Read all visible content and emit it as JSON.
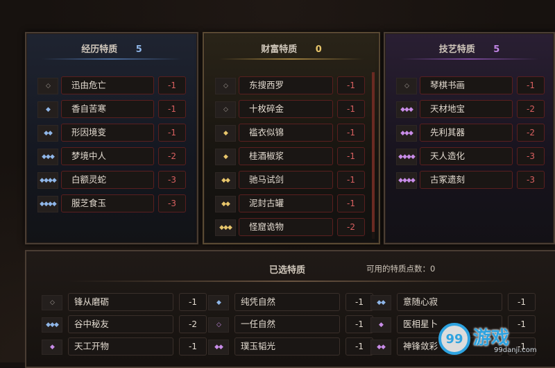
{
  "panels": {
    "experience": {
      "title": "经历特质",
      "count": "5",
      "items": [
        {
          "tier": "◇",
          "name": "迅由危亡",
          "cost": "-1"
        },
        {
          "tier": "◆",
          "name": "香自苦寒",
          "cost": "-1"
        },
        {
          "tier": "◆◆",
          "name": "形因境变",
          "cost": "-1"
        },
        {
          "tier": "◆◆◆",
          "name": "梦境中人",
          "cost": "-2"
        },
        {
          "tier": "◆◆◆◆",
          "name": "白额灵蛇",
          "cost": "-3"
        },
        {
          "tier": "◆◆◆◆",
          "name": "服芝食玉",
          "cost": "-3"
        }
      ]
    },
    "wealth": {
      "title": "财富特质",
      "count": "0",
      "items": [
        {
          "tier": "◇",
          "name": "东搜西罗",
          "cost": "-1"
        },
        {
          "tier": "◇",
          "name": "十枚碎金",
          "cost": "-1"
        },
        {
          "tier": "◆",
          "name": "褴衣似锦",
          "cost": "-1"
        },
        {
          "tier": "◆",
          "name": "桂酒椒浆",
          "cost": "-1"
        },
        {
          "tier": "◆◆",
          "name": "驰马试剑",
          "cost": "-1"
        },
        {
          "tier": "◆◆",
          "name": "泥封古罐",
          "cost": "-1"
        },
        {
          "tier": "◆◆◆",
          "name": "怪窟诡物",
          "cost": "-2"
        }
      ]
    },
    "skill": {
      "title": "技艺特质",
      "count": "5",
      "items": [
        {
          "tier": "◇",
          "name": "琴棋书画",
          "cost": "-1"
        },
        {
          "tier": "◆◆◆",
          "name": "天材地宝",
          "cost": "-2"
        },
        {
          "tier": "◆◆◆",
          "name": "先利其器",
          "cost": "-2"
        },
        {
          "tier": "◆◆◆◆",
          "name": "天人造化",
          "cost": "-3"
        },
        {
          "tier": "◆◆◆◆",
          "name": "古冢遗刻",
          "cost": "-3"
        }
      ]
    }
  },
  "selected": {
    "title": "已选特质",
    "available_label": "可用的特质点数：",
    "available_value": "0",
    "items": [
      {
        "tier": "◇",
        "color": "hollow",
        "name": "锋从磨砺",
        "cost": "-1"
      },
      {
        "tier": "◆",
        "color": "blue",
        "name": "纯凭自然",
        "cost": "-1"
      },
      {
        "tier": "◆◆",
        "color": "blue",
        "name": "意随心寂",
        "cost": "-1"
      },
      {
        "tier": "◆◆◆",
        "color": "blue",
        "name": "谷中秘友",
        "cost": "-2"
      },
      {
        "tier": "◇",
        "color": "purple",
        "name": "一任自然",
        "cost": "-1"
      },
      {
        "tier": "◆",
        "color": "purple",
        "name": "医相星卜",
        "cost": "-1"
      },
      {
        "tier": "◆",
        "color": "purple",
        "name": "天工开物",
        "cost": "-1"
      },
      {
        "tier": "◆◆",
        "color": "purple",
        "name": "璞玉韬光",
        "cost": "-1"
      },
      {
        "tier": "◆◆",
        "color": "purple",
        "name": "神锋敛彩",
        "cost": "-1"
      }
    ]
  },
  "watermark": {
    "logo": "99",
    "main": "游戏",
    "sub": "99danji.com"
  },
  "colors": {
    "blue": "#8fb6e8",
    "gold": "#e7c56b",
    "purple": "#c88ce8",
    "cost_red": "#d96060"
  }
}
